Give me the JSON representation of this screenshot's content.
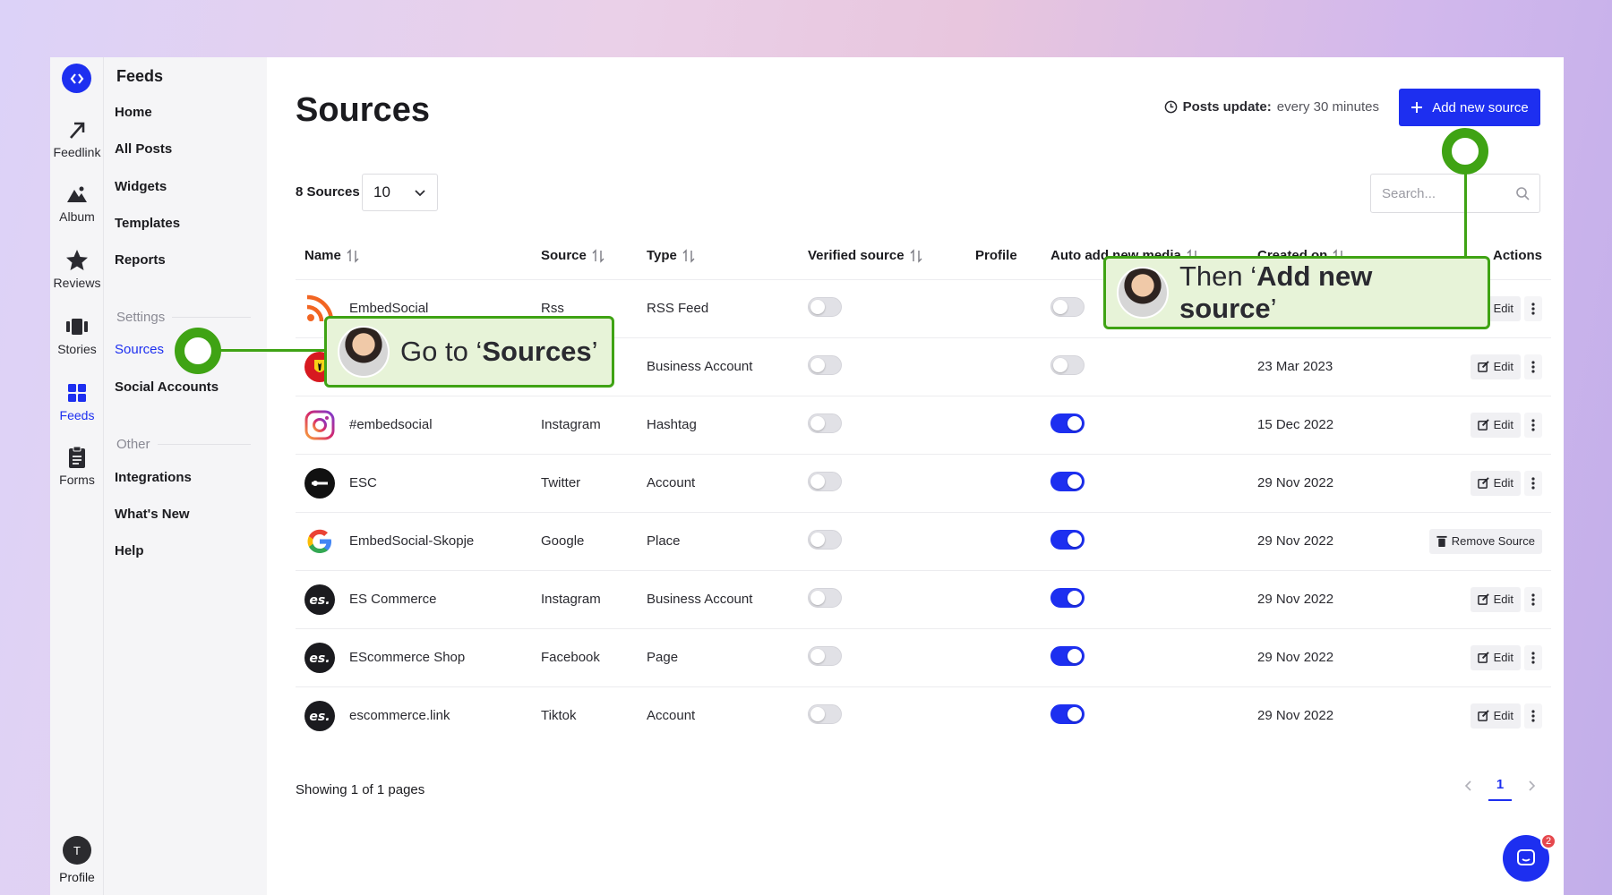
{
  "rail": {
    "items": [
      {
        "label": "Feedlink",
        "icon": "arrow-up-right-icon"
      },
      {
        "label": "Album",
        "icon": "mountain-icon"
      },
      {
        "label": "Reviews",
        "icon": "star-icon"
      },
      {
        "label": "Stories",
        "icon": "stories-icon"
      },
      {
        "label": "Feeds",
        "icon": "grid-icon"
      },
      {
        "label": "Forms",
        "icon": "clipboard-icon"
      }
    ],
    "profile_initial": "T",
    "profile_label": "Profile"
  },
  "sidebar": {
    "title": "Feeds",
    "items": [
      "Home",
      "All Posts",
      "Widgets",
      "Templates",
      "Reports"
    ],
    "settings_header": "Settings",
    "settings_items": [
      "Sources",
      "Social Accounts"
    ],
    "other_header": "Other",
    "other_items": [
      "Integrations",
      "What's New",
      "Help"
    ]
  },
  "header": {
    "title": "Sources",
    "posts_update_label": "Posts update:",
    "posts_update_value": "every 30 minutes",
    "add_button": "Add new source"
  },
  "controls": {
    "count": "8 Sources",
    "per_page": "10",
    "search_placeholder": "Search..."
  },
  "table": {
    "columns": [
      "Name",
      "Source",
      "Type",
      "Verified source",
      "Profile",
      "Auto add new media",
      "Created on",
      "Actions"
    ],
    "rows": [
      {
        "name": "EmbedSocial",
        "source": "Rss",
        "type": "RSS Feed",
        "verified": false,
        "auto": false,
        "created": "",
        "action": "Edit",
        "icon": "rss-icon"
      },
      {
        "name": "",
        "source": "",
        "type": "Business Account",
        "verified": false,
        "auto": false,
        "created": "23 Mar 2023",
        "action": "Edit",
        "icon": "ferrari-icon"
      },
      {
        "name": "#embedsocial",
        "source": "Instagram",
        "type": "Hashtag",
        "verified": false,
        "auto": true,
        "created": "15 Dec 2022",
        "action": "Edit",
        "icon": "instagram-icon"
      },
      {
        "name": "ESC",
        "source": "Twitter",
        "type": "Account",
        "verified": false,
        "auto": true,
        "created": "29 Nov 2022",
        "action": "Edit",
        "icon": "esc-icon"
      },
      {
        "name": "EmbedSocial-Skopje",
        "source": "Google",
        "type": "Place",
        "verified": false,
        "auto": true,
        "created": "29 Nov 2022",
        "action": "Remove Source",
        "icon": "google-icon"
      },
      {
        "name": "ES Commerce",
        "source": "Instagram",
        "type": "Business Account",
        "verified": false,
        "auto": true,
        "created": "29 Nov 2022",
        "action": "Edit",
        "icon": "es-logo-icon"
      },
      {
        "name": "EScommerce Shop",
        "source": "Facebook",
        "type": "Page",
        "verified": false,
        "auto": true,
        "created": "29 Nov 2022",
        "action": "Edit",
        "icon": "es-logo-icon"
      },
      {
        "name": "escommerce.link",
        "source": "Tiktok",
        "type": "Account",
        "verified": false,
        "auto": true,
        "created": "29 Nov 2022",
        "action": "Edit",
        "icon": "es-logo-icon"
      }
    ]
  },
  "footer": {
    "showing": "Showing 1 of 1 pages",
    "current_page": "1"
  },
  "chat_badge": "2",
  "callouts": {
    "sources_prefix": "Go to ‘",
    "sources_bold": "Sources",
    "sources_suffix": "’",
    "add_prefix": "Then ‘",
    "add_bold": "Add new source",
    "add_suffix": "’"
  },
  "colors": {
    "accent": "#1d2ff0",
    "callout_green": "#3fa314",
    "callout_bg": "#e7f3d8"
  }
}
